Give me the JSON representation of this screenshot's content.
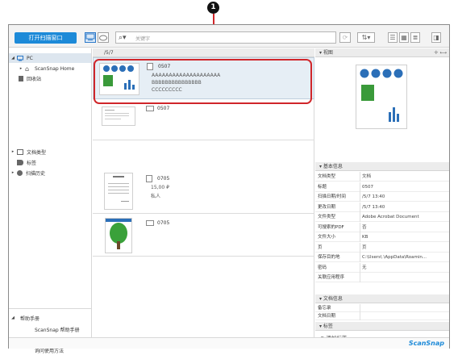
{
  "callout": {
    "number": "1"
  },
  "toolbar": {
    "open_button": "打开扫描窗口",
    "search_placeholder": "关键字"
  },
  "sidebar": {
    "pc": "PC",
    "scansnap_home": "ScanSnap Home",
    "recycle": "回收站",
    "doc_type": "文档类型",
    "tags": "标签",
    "scan_history": "扫描历史",
    "help_header": "帮助手册",
    "help_items": [
      "ScanSnap 帮助手册",
      "疑难解答",
      "询问使用方法"
    ]
  },
  "list": {
    "header": "/5/7",
    "items": [
      {
        "title": "0507",
        "line1": "AAAAAAAAAAAAAAAAAAAA",
        "line2": "BBBBBBBBBBBBBBB",
        "line3": "CCCCCCCCC"
      },
      {
        "title": "0507",
        "line1": "",
        "line2": "",
        "line3": ""
      },
      {
        "title": "0705",
        "line1": "15,00 ₽",
        "line2": "私人",
        "line3": ""
      },
      {
        "title": "0705",
        "line1": "",
        "line2": "",
        "line3": ""
      }
    ]
  },
  "right": {
    "view_header": "视图",
    "info_header": "基本信息",
    "props": [
      {
        "k": "文档类型",
        "v": "文档"
      },
      {
        "k": "标题",
        "v": "0507"
      },
      {
        "k": "扫描日期/时间",
        "v": "/5/7 13:40"
      },
      {
        "k": "更改日期",
        "v": "/5/7 13:40"
      },
      {
        "k": "文件类型",
        "v": "Adobe Acrobat Document"
      },
      {
        "k": "可搜索的PDF",
        "v": "否"
      },
      {
        "k": "文件大小",
        "v": "KB"
      },
      {
        "k": "页",
        "v": "页"
      },
      {
        "k": "保存目的地",
        "v": "C:\\Users\\        \\AppData\\Roamin..."
      },
      {
        "k": "密码",
        "v": "无"
      },
      {
        "k": "关联应用程序",
        "v": ""
      }
    ],
    "doc_info_header": "文档信息",
    "doc_props": [
      {
        "k": "备忘录",
        "v": ""
      },
      {
        "k": "文档日期",
        "v": ""
      }
    ],
    "tag_header": "标签",
    "add_tag": "添加标签"
  },
  "status": {
    "brand": "ScanSnap"
  }
}
